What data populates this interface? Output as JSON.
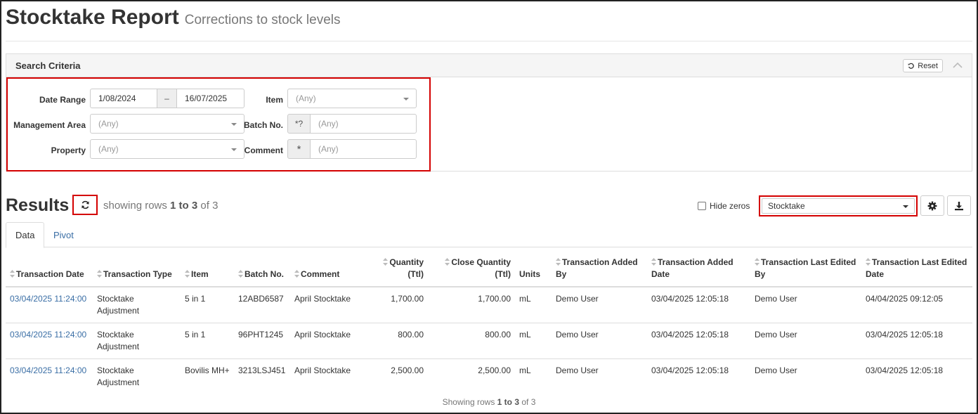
{
  "page": {
    "title": "Stocktake Report",
    "subtitle": "Corrections to stock levels"
  },
  "search": {
    "title": "Search Criteria",
    "reset_label": "Reset",
    "date_range_label": "Date Range",
    "date_from": "1/08/2024",
    "date_sep": "–",
    "date_to": "16/07/2025",
    "item_label": "Item",
    "item_placeholder": "(Any)",
    "management_area_label": "Management Area",
    "management_area_placeholder": "(Any)",
    "batch_label": "Batch No.",
    "batch_addon": "*?",
    "batch_placeholder": "(Any)",
    "property_label": "Property",
    "property_placeholder": "(Any)",
    "comment_label": "Comment",
    "comment_addon": "*",
    "comment_placeholder": "(Any)"
  },
  "results": {
    "title": "Results",
    "showing_prefix": "showing rows",
    "showing_range": "1 to 3",
    "showing_of": "of 3",
    "hide_zeros_label": "Hide zeros",
    "report_select_value": "Stocktake"
  },
  "tabs": [
    {
      "label": "Data"
    },
    {
      "label": "Pivot"
    }
  ],
  "table": {
    "columns": [
      "Transaction Date",
      "Transaction Type",
      "Item",
      "Batch No.",
      "Comment",
      "Quantity (Ttl)",
      "Close Quantity (Ttl)",
      "Units",
      "Transaction Added By",
      "Transaction Added Date",
      "Transaction Last Edited By",
      "Transaction Last Edited Date"
    ],
    "rows": [
      [
        "03/04/2025 11:24:00",
        "Stocktake Adjustment",
        "5 in 1",
        "12ABD6587",
        "April Stocktake",
        "1,700.00",
        "1,700.00",
        "mL",
        "Demo User",
        "03/04/2025 12:05:18",
        "Demo User",
        "04/04/2025 09:12:05"
      ],
      [
        "03/04/2025 11:24:00",
        "Stocktake Adjustment",
        "5 in 1",
        "96PHT1245",
        "April Stocktake",
        "800.00",
        "800.00",
        "mL",
        "Demo User",
        "03/04/2025 12:05:18",
        "Demo User",
        "03/04/2025 12:05:18"
      ],
      [
        "03/04/2025 11:24:00",
        "Stocktake Adjustment",
        "Bovilis MH+",
        "3213LSJ451",
        "April Stocktake",
        "2,500.00",
        "2,500.00",
        "mL",
        "Demo User",
        "03/04/2025 12:05:18",
        "Demo User",
        "03/04/2025 12:05:18"
      ]
    ]
  },
  "footer": {
    "prefix": "Showing rows",
    "range": "1 to 3",
    "of": "of 3"
  },
  "colors": {
    "highlight": "#d40000",
    "link": "#3a6ea5"
  }
}
